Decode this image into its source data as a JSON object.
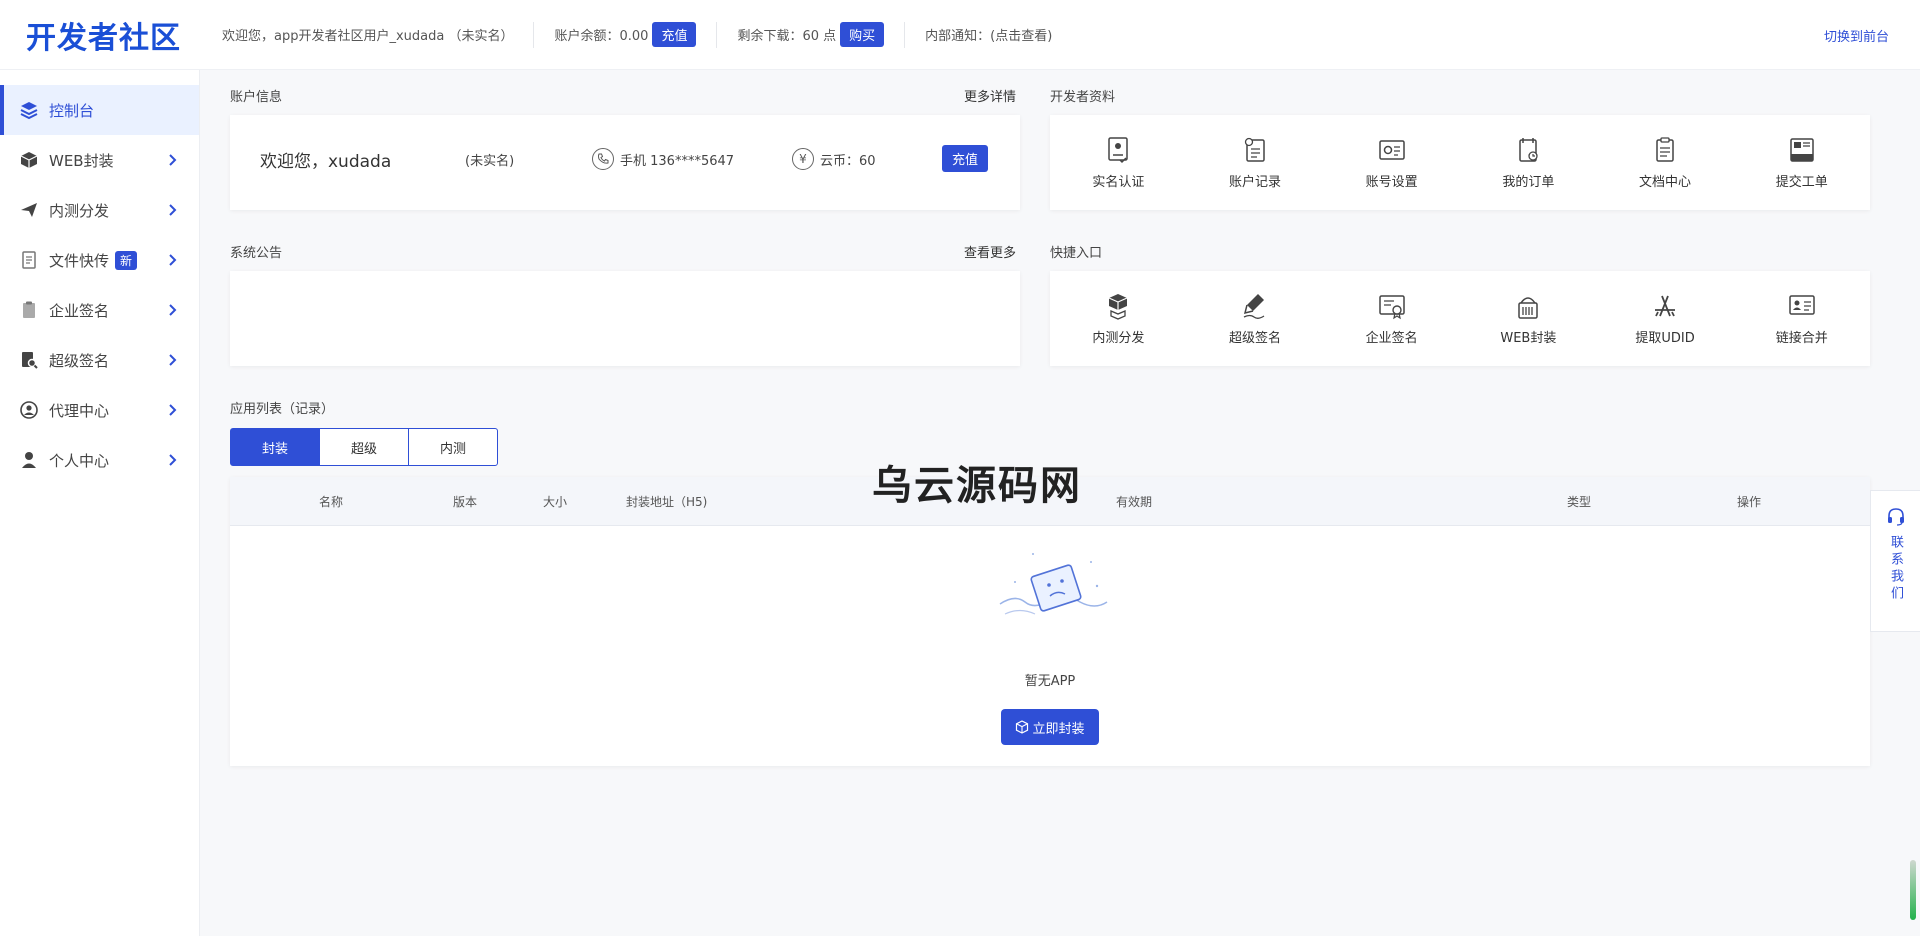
{
  "header": {
    "logo": "开发者社区",
    "welcome": "欢迎您，app开发者社区用户_xudada （未实名）",
    "balance_label": "账户余额：0.00",
    "recharge_label": "充值",
    "downloads_label": "剩余下载：60 点",
    "buy_label": "购买",
    "notice_label": "内部通知：(点击查看)",
    "switch_label": "切换到前台"
  },
  "sidebar": {
    "items": [
      {
        "label": "控制台",
        "icon": "layers-icon",
        "active": true
      },
      {
        "label": "WEB封装",
        "icon": "box-icon"
      },
      {
        "label": "内测分发",
        "icon": "paper-plane-icon"
      },
      {
        "label": "文件快传",
        "icon": "file-icon",
        "badge": "新"
      },
      {
        "label": "企业签名",
        "icon": "clipboard-icon"
      },
      {
        "label": "超级签名",
        "icon": "search-doc-icon"
      },
      {
        "label": "代理中心",
        "icon": "agent-icon"
      },
      {
        "label": "个人中心",
        "icon": "user-icon"
      }
    ]
  },
  "account": {
    "title": "账户信息",
    "more": "更多详情",
    "welcome": "欢迎您，xudada",
    "real_name": "(未实名)",
    "phone": "手机 136****5647",
    "coins": "云币：60",
    "recharge": "充值"
  },
  "developer": {
    "title": "开发者资料",
    "items": [
      {
        "label": "实名认证",
        "icon": "verify-icon"
      },
      {
        "label": "账户记录",
        "icon": "record-icon"
      },
      {
        "label": "账号设置",
        "icon": "settings-icon"
      },
      {
        "label": "我的订单",
        "icon": "order-icon"
      },
      {
        "label": "文档中心",
        "icon": "document-icon"
      },
      {
        "label": "提交工单",
        "icon": "ticket-icon"
      }
    ]
  },
  "announcement": {
    "title": "系统公告",
    "more": "查看更多"
  },
  "quick": {
    "title": "快捷入口",
    "items": [
      {
        "label": "内测分发",
        "icon": "cubes-icon"
      },
      {
        "label": "超级签名",
        "icon": "pen-icon"
      },
      {
        "label": "企业签名",
        "icon": "certificate-icon"
      },
      {
        "label": "WEB封装",
        "icon": "package-icon"
      },
      {
        "label": "提取UDID",
        "icon": "app-store-icon"
      },
      {
        "label": "链接合并",
        "icon": "link-card-icon"
      }
    ]
  },
  "apps": {
    "title": "应用列表（记录）",
    "tabs": [
      "封装",
      "超级",
      "内测"
    ],
    "active_tab": 0,
    "columns": [
      "名称",
      "版本",
      "大小",
      "封装地址（H5)",
      "有效期",
      "类型",
      "操作"
    ],
    "empty_text": "暂无APP",
    "empty_button": "立即封装"
  },
  "watermark": "乌云源码网",
  "contact": "联系我们",
  "colors": {
    "primary": "#2f4fd6",
    "logo": "#1a4fd6",
    "active_bg": "#eaf1ff"
  }
}
